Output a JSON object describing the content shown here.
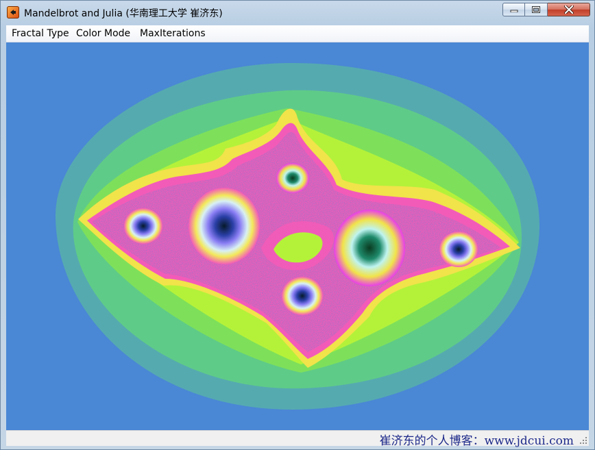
{
  "window": {
    "title": "Mandelbrot and Julia (华南理工大学 崔济东)"
  },
  "menu": {
    "items": [
      "Fractal Type",
      "Color Mode",
      "MaxIterations"
    ]
  },
  "canvas": {
    "background_color": "#4a87d5",
    "band_colors": [
      "#55aab0",
      "#5fcb88",
      "#7ee05a",
      "#b4f23a",
      "#f1e34a",
      "#f7a34a",
      "#f35bb8",
      "#e83dea",
      "#8a7df4",
      "#4fdbe8"
    ]
  },
  "statusbar": {
    "text": "崔济东的个人博客：www.jdcui.com"
  },
  "icons": [
    "app-icon",
    "minimize-icon",
    "maximize-icon",
    "close-icon",
    "resize-grip-icon"
  ]
}
